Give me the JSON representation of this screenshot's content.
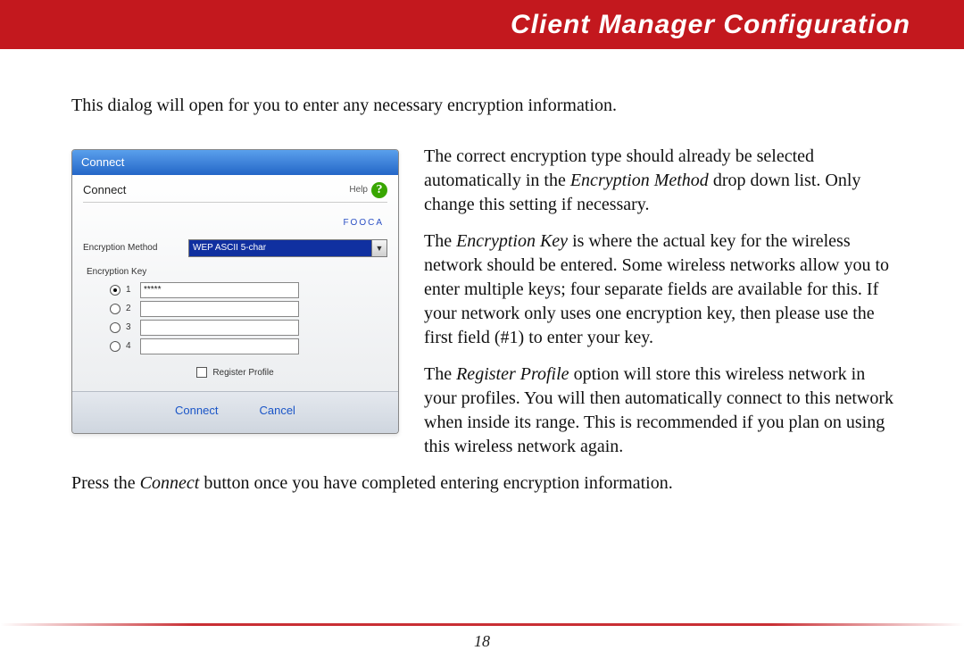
{
  "header": {
    "title": "Client Manager Configuration"
  },
  "intro": "This dialog will open for you to enter any necessary encryption information.",
  "screenshot": {
    "titlebar": "Connect",
    "section_label": "Connect",
    "help_label": "Help",
    "help_icon": "?",
    "network_name": "FOOCA",
    "enc_method_label": "Encryption Method",
    "enc_method_value": "WEP ASCII 5-char",
    "enc_key_label": "Encryption Key",
    "keys": [
      {
        "num": "1",
        "selected": true,
        "value": "*****"
      },
      {
        "num": "2",
        "selected": false,
        "value": ""
      },
      {
        "num": "3",
        "selected": false,
        "value": ""
      },
      {
        "num": "4",
        "selected": false,
        "value": ""
      }
    ],
    "register_label": "Register Profile",
    "connect_btn": "Connect",
    "cancel_btn": "Cancel"
  },
  "para1": {
    "a": "The correct encryption type should already be selected automatically in the ",
    "i": "Encryption Method",
    "b": " drop down list.  Only change this setting if necessary."
  },
  "para2": {
    "a": "The ",
    "i": "Encryption Key",
    "b": " is where the actual key for the wireless network should be entered.  Some wireless networks allow you to enter multiple keys; four separate fields are available for this.  If your network only uses one encryption key, then please use the first field (#1) to enter your key."
  },
  "para3": {
    "a": "The ",
    "i": "Register Profile",
    "b": " option will store this wireless network in your profiles.  You will then automatically connect to this network when inside its range.  This is recommended if you plan on using this wireless network again."
  },
  "para4": {
    "a": "Press the ",
    "i": "Connect",
    "b": " button once you have completed entering encryption information."
  },
  "page_number": "18"
}
